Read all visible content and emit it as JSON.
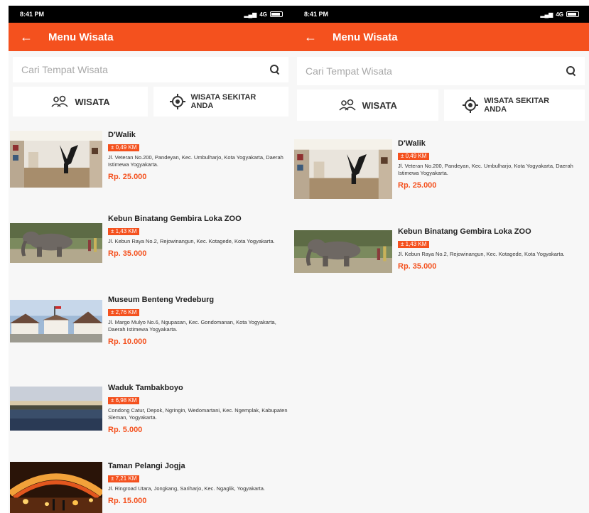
{
  "phones": [
    {
      "status": {
        "time": "8:41 PM",
        "network": "4G"
      },
      "appbar": {
        "title": "Menu Wisata"
      },
      "search": {
        "placeholder": "Cari Tempat Wisata"
      },
      "buttons": {
        "wisata": "WISATA",
        "sekitar_line1": "WISATA SEKITAR",
        "sekitar_line2": "ANDA"
      },
      "places": [
        {
          "name": "D'Walik",
          "distance": "± 0,49 KM",
          "address": "Jl. Veteran No.200, Pandeyan, Kec. Umbulharjo, Kota Yogyakarta, Daerah Istimewa Yogyakarta.",
          "price": "Rp. 25.000"
        },
        {
          "name": "Kebun Binatang Gembira Loka ZOO",
          "distance": "± 1,43 KM",
          "address": "Jl. Kebun Raya No.2, Rejowinangun, Kec. Kotagede, Kota Yogyakarta.",
          "price": "Rp. 35.000"
        },
        {
          "name": "Museum Benteng Vredeburg",
          "distance": "± 2,76 KM",
          "address": "Jl. Margo Mulyo No.6, Ngupasan, Kec. Gondomanan, Kota Yogyakarta, Daerah Istimewa Yogyakarta.",
          "price": "Rp. 10.000"
        },
        {
          "name": "Waduk Tambakboyo",
          "distance": "± 6,98 KM",
          "address": "Condong Catur, Depok, Ngringin, Wedomartani, Kec. Ngemplak, Kabupaten Sleman, Yogyakarta.",
          "price": "Rp. 5.000"
        },
        {
          "name": "Taman Pelangi Jogja",
          "distance": "± 7,21 KM",
          "address": "Jl. Ringroad Utara, Jongkang, Sariharjo, Kec. Ngaglik, Yogyakarta.",
          "price": "Rp. 15.000"
        }
      ]
    },
    {
      "status": {
        "time": "8:41 PM",
        "network": "4G"
      },
      "appbar": {
        "title": "Menu Wisata"
      },
      "search": {
        "placeholder": "Cari Tempat Wisata"
      },
      "buttons": {
        "wisata": "WISATA",
        "sekitar_line1": "WISATA SEKITAR",
        "sekitar_line2": "ANDA"
      },
      "places": [
        {
          "name": "D'Walik",
          "distance": "± 0,49 KM",
          "address": "Jl. Veteran No.200, Pandeyan, Kec. Umbulharjo, Kota Yogyakarta, Daerah Istimewa Yogyakarta.",
          "price": "Rp. 25.000"
        },
        {
          "name": "Kebun Binatang Gembira Loka ZOO",
          "distance": "± 1,43 KM",
          "address": "Jl. Kebun Raya No.2, Rejowinangun, Kec. Kotagede, Kota Yogyakarta.",
          "price": "Rp. 35.000"
        }
      ]
    }
  ],
  "colors": {
    "accent": "#f4511e",
    "background": "#f7f7f7"
  },
  "icons": {
    "back": "arrow-left-icon",
    "search": "search-icon",
    "wisata": "map-people-icon",
    "sekitar": "location-target-icon"
  }
}
